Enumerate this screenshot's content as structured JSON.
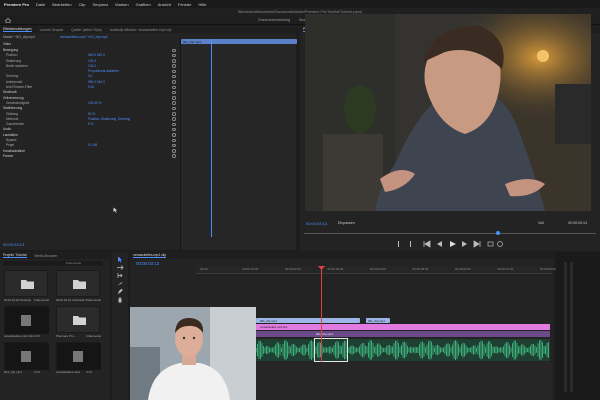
{
  "menubar": {
    "app": "Premiere Pro",
    "items": [
      "Datei",
      "Bearbeiten",
      "Clip",
      "Sequenz",
      "Marken",
      "Grafiken",
      "Ansicht",
      "Fenster",
      "Hilfe"
    ]
  },
  "window_title": "/Benutzer/dirkhuebner/Documents/Adobe/Premiere Pro/Tutorial/Tutorial.prproj",
  "workspace": {
    "tabs": [
      "Zusammenstellung",
      "Bearbeitung",
      "Farbe",
      "Effekte",
      "Audio",
      "Grafiken",
      "Bibliotheken"
    ],
    "active": "Effekte"
  },
  "effect_controls": {
    "tabs": [
      "Effekteinstellungen",
      "Lumetri Scopes",
      "Quelle: (keine Clips)",
      "Audioclip-Mischer: verwackeltes.mp4 clip"
    ],
    "source": "Master * 001_clip.mp4",
    "sequence": "verwackeltes.mp4 * 001_clip.mp4",
    "section_video": "Video",
    "rows": [
      {
        "label": "Bewegung",
        "value": "",
        "section": true
      },
      {
        "label": "Position",
        "value": "960,0    540,0"
      },
      {
        "label": "Skalierung",
        "value": "100,0"
      },
      {
        "label": "Breite skalieren",
        "value": "100,0"
      },
      {
        "label": "",
        "value": "Proportional skalieren"
      },
      {
        "label": "Drehung",
        "value": "0,0"
      },
      {
        "label": "Ankerpunkt",
        "value": "960,0    540,0"
      },
      {
        "label": "Anti-Flimmer-Filter",
        "value": "0,00"
      },
      {
        "label": "Deckkraft",
        "value": "",
        "section": true
      },
      {
        "label": "Zeitverzerrung",
        "value": "",
        "section": true
      },
      {
        "label": "Geschwindigkeit",
        "value": "100,00 %"
      },
      {
        "label": "Stabilisierung",
        "value": "",
        "section": true
      },
      {
        "label": "Glättung",
        "value": "50 %"
      },
      {
        "label": "Methode",
        "value": "Position, Skalierung, Drehung"
      },
      {
        "label": "Zuschneiden",
        "value": "5 %"
      },
      {
        "label": "Audio",
        "value": "",
        "section": true
      },
      {
        "label": "Lautstärke",
        "value": "",
        "section": true
      },
      {
        "label": "Bypass",
        "value": ""
      },
      {
        "label": "Pegel",
        "value": "0,0 dB"
      },
      {
        "label": "Kanallautstärke",
        "value": "",
        "section": true
      },
      {
        "label": "Panner",
        "value": "",
        "section": true
      }
    ],
    "mini_timeline_clip": "001_clip.mp4",
    "timecode": "00:00:03:13"
  },
  "program_monitor": {
    "title": "Programm: verwackeltes.mp4 clip",
    "timecode": "00:00:03:13",
    "fit": "Einpassen",
    "quality": "Voll",
    "duration": "00:00:03:13"
  },
  "project": {
    "tabs": [
      "Projekt: Tutorial",
      "Media-Browser"
    ],
    "search_placeholder": "",
    "count": "8 Elemente",
    "items": [
      {
        "name": "2019-10-20 Desktop",
        "meta": "6 Elemente"
      },
      {
        "name": "2019-10-21 Arbeitsab...",
        "meta": "8 Elemente"
      },
      {
        "name": "verwackeltes.mp4 clip",
        "meta": "3:13"
      },
      {
        "name": "Premiere Pro ...",
        "meta": "4 Elemente"
      },
      {
        "name": "001_clip.mp4",
        "meta": "3:13"
      },
      {
        "name": "verwackeltes.mp4",
        "meta": "3:13"
      }
    ]
  },
  "timeline": {
    "tab": "verwackeltes.mp4 clip",
    "timecode": "00:00:03:13",
    "ruler": [
      "00:00",
      "00:00:01:00",
      "00:00:02:00",
      "00:00:03:00",
      "00:00:04:00",
      "00:00:05:00",
      "00:00:06:00",
      "00:00:07:00",
      "00:00:08:00"
    ],
    "clips": {
      "v2a": "001_clip.mp4",
      "v2b": "001_clip.mp4",
      "v1": "verwackeltes.mp4 clip",
      "a1": "001_clip.mp4"
    }
  },
  "colors": {
    "accent": "#4a90ff",
    "clip_pink": "#e27be1",
    "clip_blue": "#9cb6e8",
    "audio_green": "#3ba877",
    "playhead": "#e04040"
  }
}
